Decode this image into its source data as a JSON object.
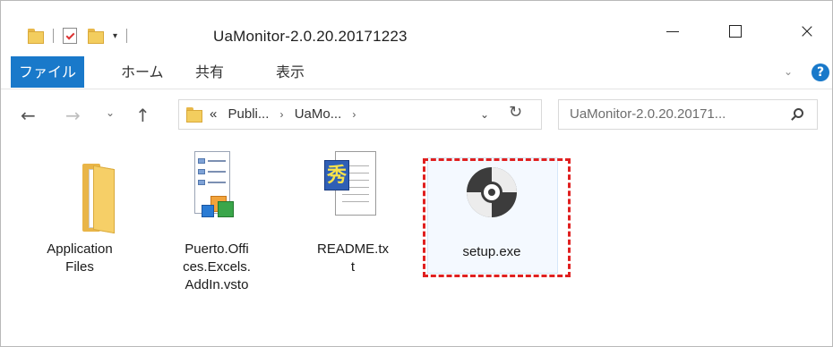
{
  "window": {
    "title": "UaMonitor-2.0.20.20171223",
    "controls": {
      "minimize": "minimize",
      "maximize": "maximize",
      "close": "×"
    }
  },
  "quick_access": {
    "dropdown": "▾"
  },
  "ribbon": {
    "tabs": [
      {
        "label": "ファイル",
        "active": true
      },
      {
        "label": "ホーム"
      },
      {
        "label": "共有"
      },
      {
        "label": "表示"
      }
    ],
    "expand_chevron": "⌄",
    "help": "?"
  },
  "nav": {
    "back": "←",
    "forward": "→",
    "recent": "⌄",
    "up": "↑",
    "address": {
      "overflow": "«",
      "crumbs": [
        "Publi...",
        "UaMo..."
      ],
      "separator": "›",
      "dropdown": "⌄",
      "refresh": "↻"
    },
    "search": {
      "placeholder": "UaMonitor-2.0.20.20171..."
    }
  },
  "items": [
    {
      "name": "Application\nFiles",
      "icon": "folder-icon"
    },
    {
      "name": "Puerto.Offi\nces.Excels.\nAddIn.vsto",
      "icon": "vsto-icon"
    },
    {
      "name": "README.tx\nt",
      "icon": "text-document-icon"
    },
    {
      "name": "setup.exe",
      "icon": "disc-icon",
      "selected": true,
      "highlight": "#e02020"
    }
  ],
  "icons": {
    "readme_glyph": "秀"
  },
  "colors": {
    "accent": "#1979ca",
    "highlight": "#e02020"
  }
}
